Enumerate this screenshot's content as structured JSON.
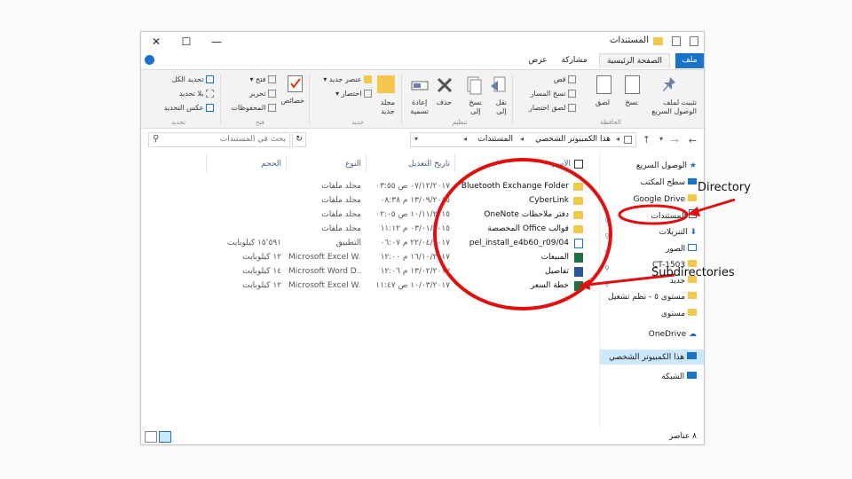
{
  "window": {
    "title": "المستندات",
    "controls": {
      "minimize": "—",
      "maximize": "☐",
      "close": "✕"
    }
  },
  "ribbon_tabs": [
    {
      "label": "ملف"
    },
    {
      "label": "الصفحة الرئيسية"
    },
    {
      "label": "مشاركة"
    },
    {
      "label": "عرض"
    }
  ],
  "ribbon": {
    "clipboard": {
      "pin": "تثبيت لملف\nالوصول السريع",
      "copy": "نسخ",
      "paste": "لصق",
      "cut": "قص",
      "copy_path": "نسخ المسار",
      "paste_shortcut": "لصق اختصار",
      "label": "الحافظة"
    },
    "organize": {
      "move_to": "نقل\nإلى",
      "copy_to": "نسخ\nإلى",
      "delete": "حذف",
      "rename": "إعادة\nتسمية",
      "label": "تنظيم"
    },
    "new": {
      "new_folder": "مجلد\nجديد",
      "new_item": "عنصر جديد",
      "easy_access": "اختصار",
      "label": "جديد"
    },
    "open": {
      "properties": "خصائص",
      "open": "فتح",
      "edit": "تحرير",
      "history": "المحفوظات",
      "label": "فتح"
    },
    "select": {
      "select_all": "تحديد الكل",
      "select_none": "بلا تحديد",
      "invert": "عكس التحديد",
      "label": "تحديد"
    }
  },
  "address": {
    "breadcrumb": [
      "هذا الكمبيوتر الشخصي",
      "المستندات"
    ],
    "search_placeholder": "بحث في المستندات"
  },
  "columns": {
    "name": "الاسم",
    "date": "تاريخ التعديل",
    "type": "النوع",
    "size": "الحجم"
  },
  "files": [
    {
      "name": "Bluetooth Exchange Folder",
      "date": "٠٧/١٢/٢٠١٧ ص ٠٣:٥٥",
      "type": "مجلد ملفات",
      "size": "",
      "icon": "folder"
    },
    {
      "name": "CyberLink",
      "date": "١٣/٠٩/٢٠١٥ م ٠٨:٣٨",
      "type": "مجلد ملفات",
      "size": "",
      "icon": "folder"
    },
    {
      "name": "دفتر ملاحظات OneNote",
      "date": "١٠/١١/٢٠١٥ ص ٠٢:٠٥",
      "type": "مجلد ملفات",
      "size": "",
      "icon": "folder"
    },
    {
      "name": "قوالب Office المخصصة",
      "date": "٠٣/٠١/٢٠١٥ م ١١:١٢",
      "type": "مجلد ملفات",
      "size": "",
      "icon": "folder"
    },
    {
      "name": "pel_install_e4b60_r09/04",
      "date": "٢٢/٠٤/٢٠١٧ م ٠٦:٠٧",
      "type": "التطبيق",
      "size": "١٥٬٥٩١ كيلوبايت",
      "icon": "app"
    },
    {
      "name": "المبيعات",
      "date": "١٦/١٠/٢٠١٧ م ١٢:٠٠",
      "type": "Microsoft Excel W...",
      "size": "١٢ كيلوبايت",
      "icon": "excel"
    },
    {
      "name": "تفاصيل",
      "date": "١٣/٠٢/٢٠١٧ م ١٢:٠٦",
      "type": "Microsoft Word D...",
      "size": "١٤ كيلوبايت",
      "icon": "word"
    },
    {
      "name": "خطة السعر",
      "date": "١٠/٠٣/٢٠١٧ ص ١١:٤٧",
      "type": "Microsoft Excel W...",
      "size": "١٢ كيلوبايت",
      "icon": "excel"
    }
  ],
  "nav": [
    {
      "label": "الوصول السريع",
      "icon": "star-icon"
    },
    {
      "label": "سطح المكتب",
      "icon": "desktop-icon"
    },
    {
      "label": "Google Drive",
      "icon": "folder-icon"
    },
    {
      "label": "المستندات",
      "icon": "documents-icon"
    },
    {
      "label": "التنزيلات",
      "icon": "download-icon"
    },
    {
      "label": "الصور",
      "icon": "pictures-icon"
    },
    {
      "label": "CT-1503",
      "icon": "folder-icon"
    },
    {
      "label": "جديد",
      "icon": "folder-icon"
    },
    {
      "label": "مستوى ٥ - نظم تشغيل",
      "icon": "folder-icon"
    },
    {
      "label": "مستوى",
      "icon": "folder-icon"
    },
    {
      "label": "OneDrive",
      "icon": "cloud-icon"
    },
    {
      "label": "هذا الكمبيوتر الشخصي",
      "icon": "computer-icon"
    },
    {
      "label": "الشبكة",
      "icon": "network-icon"
    }
  ],
  "status": {
    "items_count": "٨ عناصر"
  },
  "annotations": {
    "directory": "Directory",
    "subdirectories": "Subdirectories"
  },
  "colors": {
    "accent": "#1a73c8",
    "annotation": "#e01010",
    "selection": "#cce8ff",
    "folder": "#f2c94c"
  }
}
